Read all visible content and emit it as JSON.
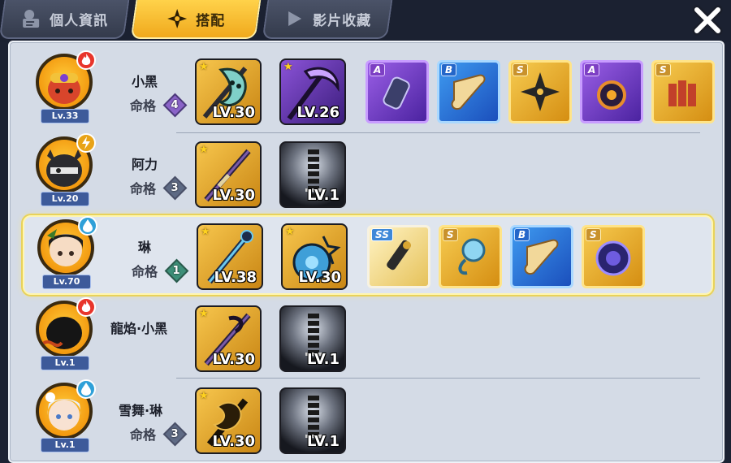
{
  "tabs": [
    {
      "label": "個人資訊",
      "icon": "profile-icon",
      "active": false
    },
    {
      "label": "搭配",
      "icon": "shuriken-icon",
      "active": true
    },
    {
      "label": "影片收藏",
      "icon": "play-icon",
      "active": false
    }
  ],
  "close_icon": "close-icon",
  "fate_label": "命格",
  "colors": {
    "fire": "#e8352b",
    "thunder": "#e8a317",
    "water": "#2fa0d8",
    "gold_tab": "#f5b62a"
  },
  "characters": [
    {
      "name": "小黑",
      "level": "Lv.33",
      "element": "fire",
      "fate": "4",
      "fate_color": "#8a63c8",
      "weapons": [
        {
          "star": "★",
          "level": "LV.30",
          "type": "gold"
        },
        {
          "star": "★",
          "level": "LV.26",
          "type": "purple"
        }
      ],
      "items": [
        {
          "grade": "A",
          "color": "p"
        },
        {
          "grade": "B",
          "color": "b"
        },
        {
          "grade": "S",
          "color": "g"
        },
        {
          "grade": "A",
          "color": "p"
        },
        {
          "grade": "S",
          "color": "g"
        }
      ]
    },
    {
      "name": "阿力",
      "level": "Lv.20",
      "element": "thunder",
      "fate": "3",
      "fate_color": "#5e6a84",
      "weapons": [
        {
          "star": "★",
          "level": "LV.30",
          "type": "gold"
        },
        {
          "star": "",
          "level": "LV.1",
          "type": "dark"
        }
      ],
      "items": []
    },
    {
      "name": "琳",
      "level": "Lv.70",
      "element": "water",
      "fate": "1",
      "fate_color": "#3d8f78",
      "weapons": [
        {
          "star": "★",
          "level": "LV.38",
          "type": "gold"
        },
        {
          "star": "★",
          "level": "LV.30",
          "type": "gold"
        }
      ],
      "items": [
        {
          "grade": "SS",
          "color": "ss"
        },
        {
          "grade": "S",
          "color": "g"
        },
        {
          "grade": "B",
          "color": "b"
        },
        {
          "grade": "S",
          "color": "g"
        }
      ]
    },
    {
      "name": "龍焰·小黑",
      "level": "Lv.1",
      "element": "fire",
      "fate": "",
      "fate_color": "",
      "weapons": [
        {
          "star": "★",
          "level": "LV.30",
          "type": "gold"
        },
        {
          "star": "",
          "level": "LV.1",
          "type": "dark"
        }
      ],
      "items": []
    },
    {
      "name": "雪舞·琳",
      "level": "Lv.1",
      "element": "water",
      "fate": "3",
      "fate_color": "#5e6a84",
      "weapons": [
        {
          "star": "★",
          "level": "LV.30",
          "type": "gold"
        },
        {
          "star": "",
          "level": "LV.1",
          "type": "dark"
        }
      ],
      "items": []
    }
  ]
}
